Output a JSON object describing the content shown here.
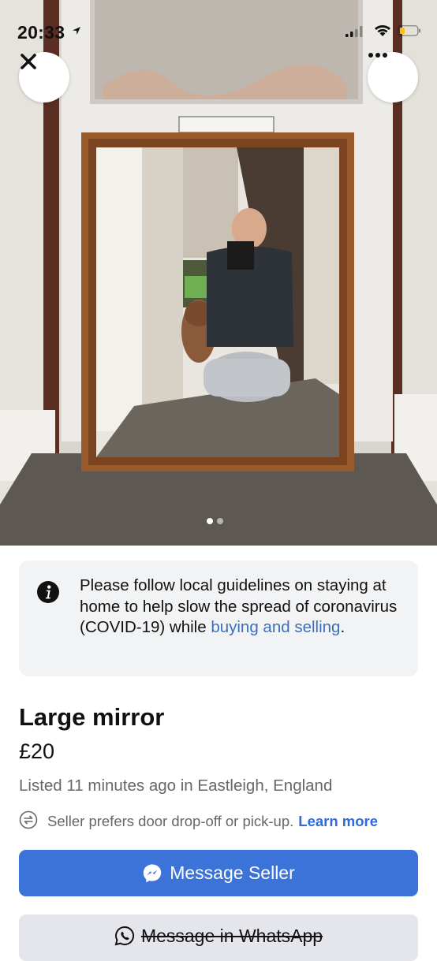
{
  "status_bar": {
    "time": "20:33"
  },
  "photo": {
    "carousel_count": 2,
    "carousel_active": 1
  },
  "notice": {
    "text": "Please follow local guidelines on staying at home to help slow the spread of coronavirus (COVID-19) while ",
    "link": "buying and selling",
    "suffix": "."
  },
  "listing": {
    "title": "Large mirror",
    "price": "£20",
    "listed": "Listed 11 minutes ago in Eastleigh, England",
    "preference": "Seller prefers door drop-off or pick-up.",
    "learn_more": "Learn more"
  },
  "actions": {
    "message_seller": "Message Seller",
    "whatsapp": "Message in WhatsApp"
  },
  "colors": {
    "accent": "#3b73d9",
    "link": "#2f6ae0"
  }
}
